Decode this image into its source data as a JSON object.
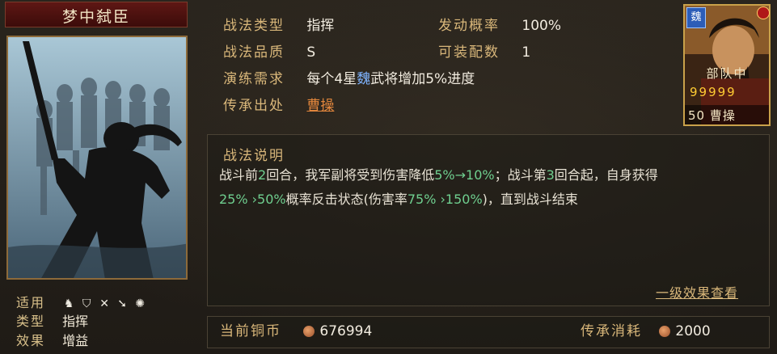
{
  "skill": {
    "name": "梦中弑臣",
    "suitable_label": "适用",
    "suitable_icons": [
      "cavalry-icon",
      "shield-icon",
      "bow-icon",
      "spear-icon",
      "siege-icon"
    ],
    "type_label": "类型",
    "type_value": "指挥",
    "effect_label": "效果",
    "effect_value": "增益"
  },
  "info": {
    "kind_label": "战法类型",
    "kind_value": "指挥",
    "rate_label": "发动概率",
    "rate_value": "100%",
    "quality_label": "战法品质",
    "quality_value": "S",
    "equip_label": "可装配数",
    "equip_value": "1",
    "train_label": "演练需求",
    "train_prefix": "每个4星",
    "train_faction": "魏",
    "train_suffix": "武将增加5%进度",
    "origin_label": "传承出处",
    "origin_value": "曹操"
  },
  "description": {
    "title": "战法说明",
    "line1_a": "战斗前",
    "line1_b": "2",
    "line1_c": "回合，我军副将受到伤害降低",
    "line1_d": "5%→10%",
    "line1_e": "；战斗第",
    "line1_f": "3",
    "line1_g": "回合起，自身获得",
    "line2_a": "25%  ›50%",
    "line2_b": "概率反击状态(伤害率",
    "line2_c": "75%  ›150%",
    "line2_d": ")，直到战斗结束",
    "effect_link": "一级效果查看"
  },
  "footer": {
    "coins_label": "当前铜币",
    "coins_value": "676994",
    "cost_label": "传承消耗",
    "cost_value": "2000"
  },
  "general": {
    "faction": "魏",
    "unit_status": "部队中",
    "stars": "99999",
    "level_name": "50 曹操"
  }
}
